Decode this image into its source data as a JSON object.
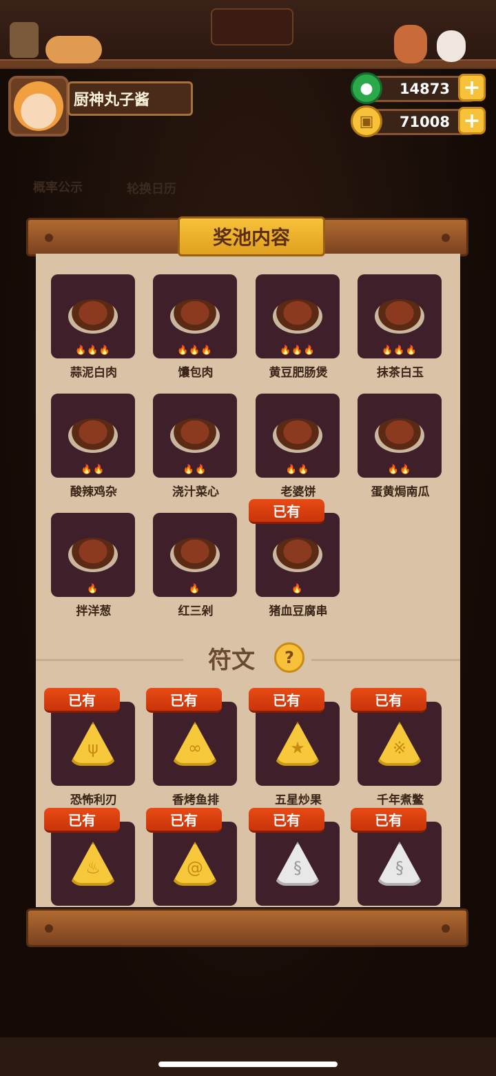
{
  "header": {
    "player_name": "厨神丸子酱",
    "jade": "14873",
    "coins": "71008"
  },
  "background_labels": {
    "probability": "概率公示",
    "calendar": "轮换日历"
  },
  "panel": {
    "title": "奖池内容",
    "owned_badge": "已有",
    "dishes": [
      {
        "name": "蒜泥白肉",
        "stars": 3,
        "owned": false
      },
      {
        "name": "馕包肉",
        "stars": 3,
        "owned": false
      },
      {
        "name": "黄豆肥肠煲",
        "stars": 3,
        "owned": false
      },
      {
        "name": "抹茶白玉",
        "stars": 3,
        "owned": false
      },
      {
        "name": "酸辣鸡杂",
        "stars": 2,
        "owned": false
      },
      {
        "name": "浇汁菜心",
        "stars": 2,
        "owned": false
      },
      {
        "name": "老婆饼",
        "stars": 2,
        "owned": false
      },
      {
        "name": "蛋黄焗南瓜",
        "stars": 2,
        "owned": false
      },
      {
        "name": "拌洋葱",
        "stars": 1,
        "owned": false
      },
      {
        "name": "红三剁",
        "stars": 1,
        "owned": false
      },
      {
        "name": "猪血豆腐串",
        "stars": 1,
        "owned": true
      }
    ],
    "rune_section_title": "符文",
    "runes": [
      {
        "name": "恐怖利刃",
        "owned": true,
        "icon": "claw-rune",
        "color": "gold"
      },
      {
        "name": "香烤鱼排",
        "owned": true,
        "icon": "fish-rune",
        "color": "gold"
      },
      {
        "name": "五星炒果",
        "owned": true,
        "icon": "star-rune",
        "color": "gold"
      },
      {
        "name": "千年煮鳖",
        "owned": true,
        "icon": "turtle-rune",
        "color": "gold"
      },
      {
        "name": "",
        "owned": true,
        "icon": "pot-rune",
        "color": "gold"
      },
      {
        "name": "",
        "owned": true,
        "icon": "spiral-rune",
        "color": "gold"
      },
      {
        "name": "",
        "owned": true,
        "icon": "swirl-rune",
        "color": "gray"
      },
      {
        "name": "",
        "owned": true,
        "icon": "swirl-rune",
        "color": "gray"
      }
    ]
  },
  "colors": {
    "accent_orange": "#e84a14",
    "gold": "#f7c23a",
    "tile": "#3e1f2a",
    "paper": "#d9c2a5"
  }
}
